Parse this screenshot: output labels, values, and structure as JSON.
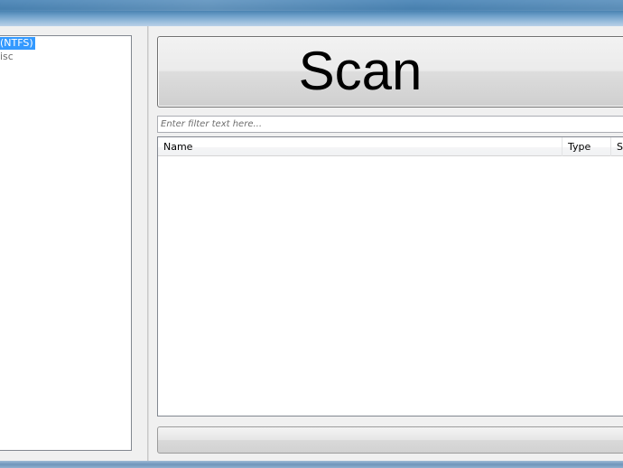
{
  "tree": {
    "items": [
      {
        "label": "(NTFS)",
        "selected": true
      },
      {
        "label": "isc",
        "selected": false
      }
    ]
  },
  "scan_button": {
    "label": "Scan"
  },
  "filter": {
    "placeholder": "Enter filter text here...",
    "value": ""
  },
  "file_list": {
    "columns": [
      {
        "label": "Name"
      },
      {
        "label": "Type"
      },
      {
        "label": "Si"
      }
    ],
    "rows": []
  },
  "progress": {
    "value": 0
  }
}
